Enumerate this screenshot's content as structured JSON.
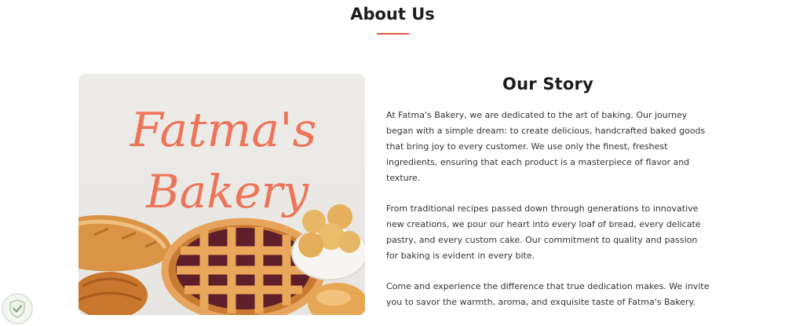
{
  "about": {
    "title": "About Us",
    "accent_color": "#e05b45"
  },
  "image": {
    "logo_line1": "Fatma's",
    "logo_line2": "Bakery",
    "logo_color": "#ec7559"
  },
  "story": {
    "title": "Our Story",
    "paragraphs": [
      "At Fatma's Bakery, we are dedicated to the art of baking. Our journey began with a simple dream: to create delicious, handcrafted baked goods that bring joy to every customer. We use only the finest, freshest ingredients, ensuring that each product is a masterpiece of flavor and texture.",
      "From traditional recipes passed down through generations to innovative new creations, we pour our heart into every loaf of bread, every delicate pastry, and every custom cake. Our commitment to quality and passion for baking is evident in every bite.",
      "Come and experience the difference that true dedication makes. We invite you to savor the warmth, aroma, and exquisite taste of Fatma's Bakery."
    ]
  },
  "badge": {
    "icon": "shield-check-icon"
  }
}
